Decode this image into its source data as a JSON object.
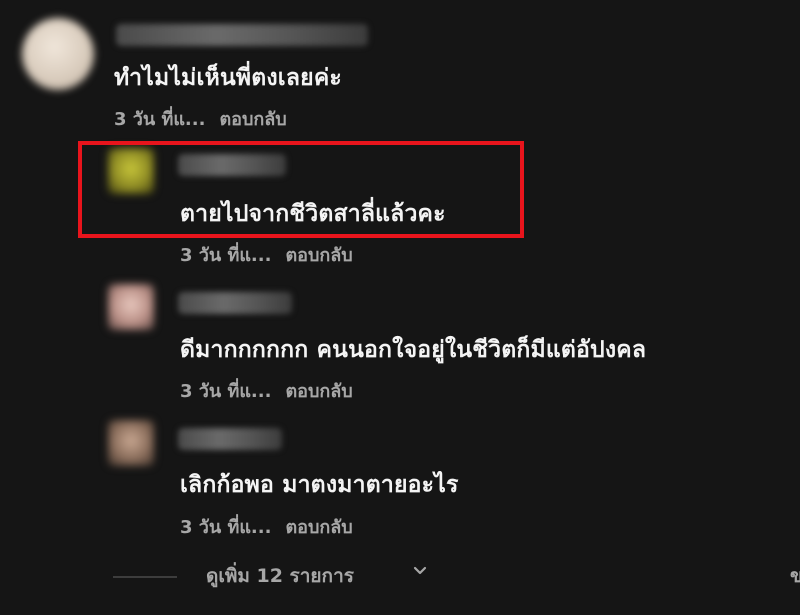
{
  "comments": [
    {
      "text": "ทำไมไม่เห็นพี่ตงเลยค่ะ",
      "time": "3 วัน ที่แ...",
      "reply": "ตอบกลับ"
    },
    {
      "text": "ตายไปจากชีวิตสาลี่แล้วคะ",
      "time": "3 วัน ที่แ...",
      "reply": "ตอบกลับ"
    },
    {
      "text": "ดีมากกกกกก คนนอกใจอยู่ในชีวิตก็มีแต่อัปงคล",
      "time": "3 วัน ที่แ...",
      "reply": "ตอบกลับ"
    },
    {
      "text": "เลิกก้อพอ มาตงมาตายอะไร",
      "time": "3 วัน ที่แ...",
      "reply": "ตอบกลับ"
    }
  ],
  "view_more": "ดูเพิ่ม 12 รายการ",
  "edge_text": "ข",
  "highlight_color": "#e8141c",
  "icons": {
    "chevron": "chevron-down-icon"
  }
}
